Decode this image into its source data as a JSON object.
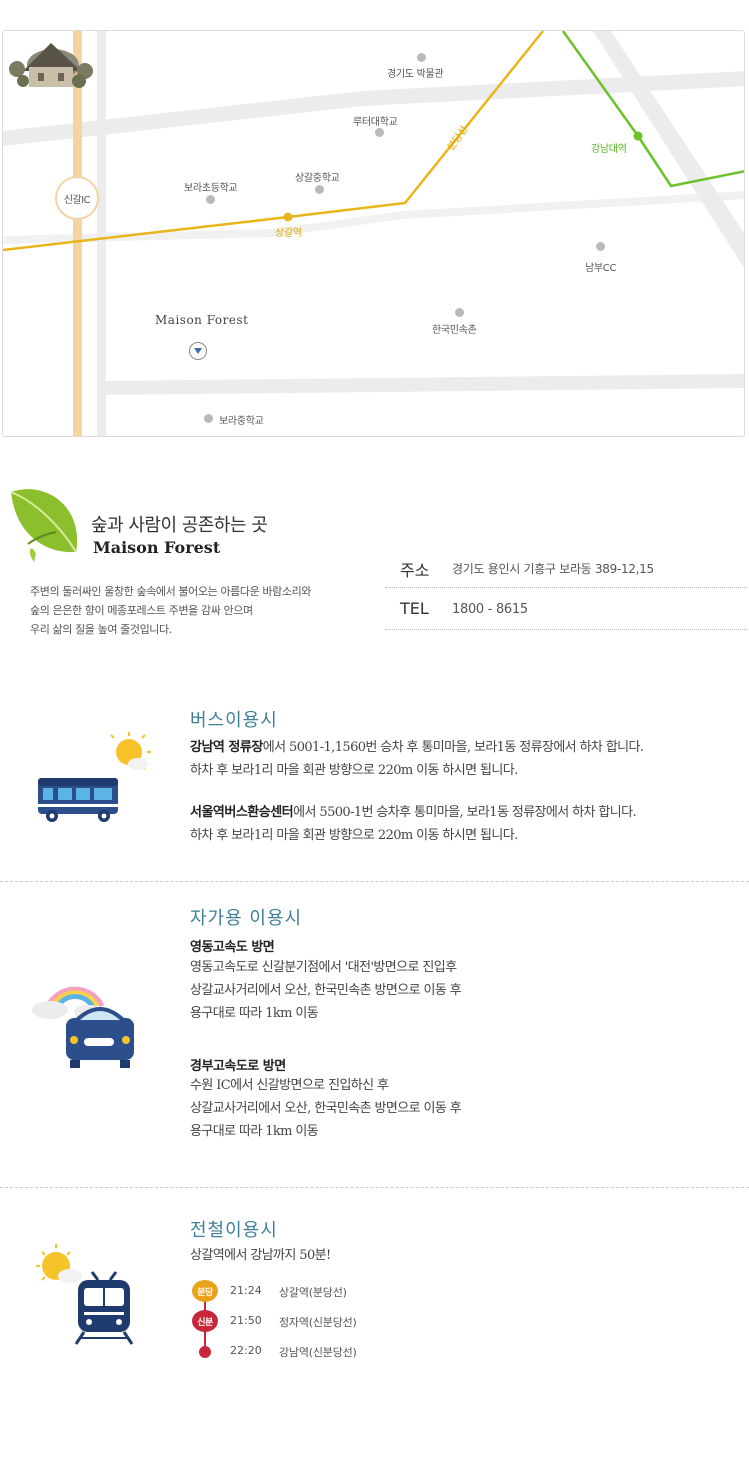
{
  "map": {
    "labels": {
      "gyeonggi_museum": "경기도 박물관",
      "luther_univ": "루터대학교",
      "sanggal_middle": "상갈중학교",
      "bora_elementary": "보라초등학교",
      "sanggal_station": "상갈역",
      "line_label": "분당선",
      "gangnam_univ_station": "강남대역",
      "nambu_cc": "남부CC",
      "korean_folk_village": "한국민속촌",
      "bora_middle": "보라중학교",
      "singal_ic": "신갈IC",
      "brand": "Maison Forest"
    },
    "colors": {
      "bundang_line": "#e8b61a",
      "everline": "#6bc12a",
      "expressway": "#f7d3a0",
      "road": "#e6e6e6"
    }
  },
  "intro": {
    "title": "숲과 사람이 공존하는 곳",
    "brand": "Maison Forest",
    "desc_lines": [
      "주변의 둘러싸인 울창한 숲속에서 불어오는 아름다운 바람소리와",
      "숲의 은은한 향이 메종포레스트 주변을 감싸 안으며",
      "우리 삶의 질을 높여 줄것입니다."
    ],
    "address_label": "주소",
    "address": "경기도 용인시 기흥구 보라동 389-12,15",
    "tel_label": "TEL",
    "tel": "1800 - 8615"
  },
  "bus": {
    "title": "버스이용시",
    "p1_bold": "강남역 정류장",
    "p1_rest": "에서 5001-1,1560번 승차 후 통미마을, 보라1동 정류장에서 하차 합니다.",
    "p1_line2": "하차 후 보라1리 마을 회관 방향으로 220m 이동 하시면 됩니다.",
    "p2_bold": "서울역버스환승센터",
    "p2_rest": "에서 5500-1번 승차후 통미마을, 보라1동 정류장에서 하차 합니다.",
    "p2_line2": "하차 후 보라1리 마을 회관 방향으로 220m 이동 하시면 됩니다."
  },
  "car": {
    "title": "자가용 이용시",
    "route1_title": "영동고속도 방면",
    "route1_lines": [
      "영동고속도로 신갈분기점에서 '대전'방면으로 진입후",
      "상갈교사거리에서 오산, 한국민속촌 방면으로 이동 후",
      "용구대로 따라 1km 이동"
    ],
    "route2_title": "경부고속도로 방면",
    "route2_lines": [
      "수원 IC에서 신갈방면으로 진입하신 후",
      "상갈교사거리에서 오산, 한국민속촌 방면으로 이동 후",
      "용구대로 따라 1km 이동"
    ]
  },
  "subway": {
    "title": "전철이용시",
    "summary": "상갈역에서 강남까지 50분!",
    "schedule": [
      {
        "badge": "분당",
        "time": "21:24",
        "station": "상갈역(분당선)",
        "color": "#e8a31a"
      },
      {
        "badge": "신분",
        "time": "21:50",
        "station": "정자역(신분당선)",
        "color": "#c8273a"
      },
      {
        "badge": "",
        "time": "22:20",
        "station": "강남역(신분당선)",
        "color": "#c8273a"
      }
    ]
  }
}
